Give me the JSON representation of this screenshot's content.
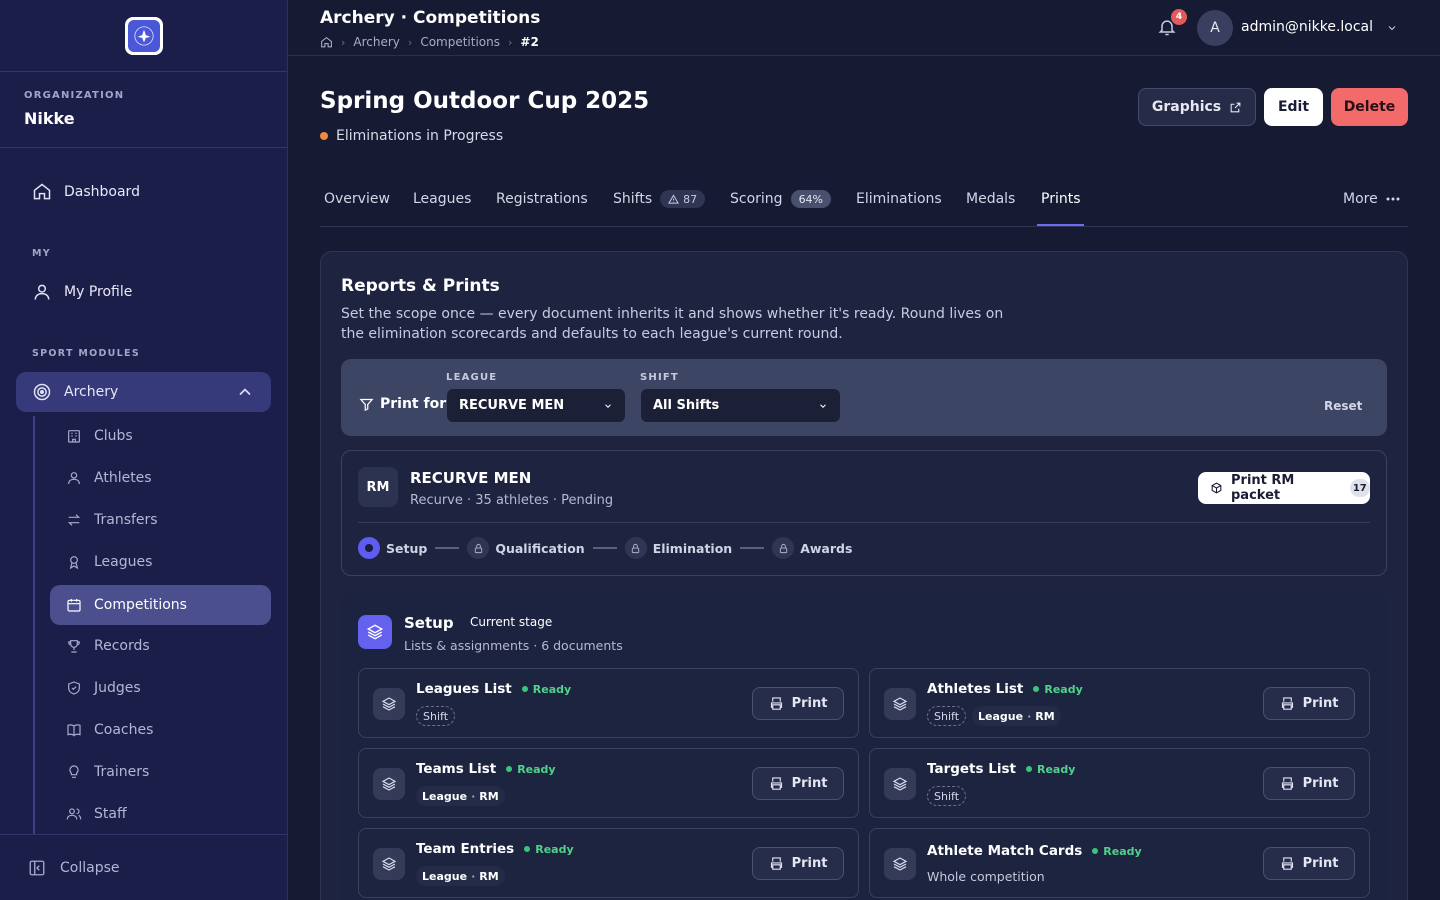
{
  "sidebar": {
    "org_label": "ORGANIZATION",
    "org_name": "Nikke",
    "dashboard": "Dashboard",
    "my_label": "MY",
    "my_profile": "My Profile",
    "sport_label": "SPORT MODULES",
    "archery": "Archery",
    "sub": [
      "Clubs",
      "Athletes",
      "Transfers",
      "Leagues",
      "Competitions",
      "Records",
      "Judges",
      "Coaches",
      "Trainers",
      "Staff"
    ],
    "collapse": "Collapse"
  },
  "header": {
    "title": "Archery · Competitions",
    "crumbs": [
      "Archery",
      "Competitions",
      "#2"
    ],
    "notifications": "4",
    "avatar_letter": "A",
    "user": "admin@nikke.local"
  },
  "page": {
    "title": "Spring Outdoor Cup 2025",
    "status": "Eliminations in Progress",
    "graphics": "Graphics",
    "edit": "Edit",
    "delete": "Delete"
  },
  "tabs": {
    "overview": "Overview",
    "leagues": "Leagues",
    "registrations": "Registrations",
    "shifts": "Shifts",
    "shifts_count": "87",
    "scoring": "Scoring",
    "scoring_pct": "64%",
    "eliminations": "Eliminations",
    "medals": "Medals",
    "prints": "Prints",
    "more": "More"
  },
  "reports": {
    "title": "Reports & Prints",
    "desc": "Set the scope once — every document inherits it and shows whether it's ready. Round lives on the elimination scorecards and defaults to each league's current round.",
    "print_for": "Print for",
    "league_label": "LEAGUE",
    "league_value": "RECURVE MEN",
    "shift_label": "SHIFT",
    "shift_value": "All Shifts",
    "reset": "Reset"
  },
  "league": {
    "abbr": "RM",
    "name": "RECURVE MEN",
    "sub": "Recurve · 35 athletes · Pending",
    "packet": "Print RM packet",
    "packet_count": "17",
    "steps": [
      "Setup",
      "Qualification",
      "Elimination",
      "Awards"
    ]
  },
  "stage": {
    "title": "Setup",
    "chip": "Current stage",
    "sub": "Lists & assignments · 6 documents"
  },
  "docs": [
    {
      "title": "Leagues List",
      "status": "Ready",
      "tag_shift": "Shift",
      "print": "Print"
    },
    {
      "title": "Athletes List",
      "status": "Ready",
      "tag_shift": "Shift",
      "tag_league": "League",
      "tag_code": "RM",
      "print": "Print"
    },
    {
      "title": "Teams List",
      "status": "Ready",
      "tag_league": "League",
      "tag_code": "RM",
      "print": "Print"
    },
    {
      "title": "Targets List",
      "status": "Ready",
      "tag_shift": "Shift",
      "print": "Print"
    },
    {
      "title": "Team Entries",
      "status": "Ready",
      "tag_league": "League",
      "tag_code": "RM",
      "print": "Print"
    },
    {
      "title": "Athlete Match Cards",
      "status": "Ready",
      "note": "Whole competition",
      "print": "Print"
    }
  ],
  "colors": {
    "accent": "#6f6cf0",
    "ready": "#4fd28a",
    "danger": "#f36a6a",
    "status_dot": "#f08a3c"
  }
}
